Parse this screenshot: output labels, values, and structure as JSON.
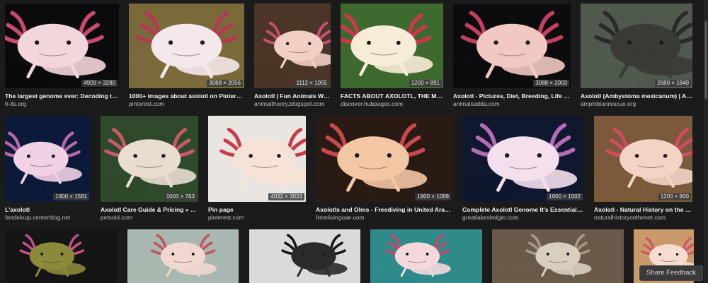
{
  "results": [
    {
      "title": "The largest genome ever: Decoding th...",
      "source": "h-its.org",
      "dims": "4928 × 3280",
      "colors": {
        "bg": "#0b0b0d",
        "body": "#f3d6dc",
        "gill": "#c94a6c"
      }
    },
    {
      "title": "1000+ images about axolotl on Pinteres...",
      "source": "pinterest.com",
      "dims": "3088 × 2056",
      "colors": {
        "bg": "#7a6a3a",
        "body": "#f4e8ea",
        "gill": "#b43a52"
      }
    },
    {
      "title": "Axolotl | Fun Animals Wiki...",
      "source": "animaltheory.blogspot.com",
      "dims": "1112 × 1055",
      "colors": {
        "bg": "#4a3526",
        "body": "#f1cfc4",
        "gill": "#c8506e"
      }
    },
    {
      "title": "FACTS ABOUT AXOLOTL, THE ME...",
      "source": "discover.hubpages.com",
      "dims": "1200 × 891",
      "colors": {
        "bg": "#3f6a2f",
        "body": "#f7ecd8",
        "gill": "#d8324e"
      }
    },
    {
      "title": "Axolotl - Pictures, Diet, Breeding, Life Cy...",
      "source": "animalsadda.com",
      "dims": "3088 × 2003",
      "colors": {
        "bg": "#0c0c0e",
        "body": "#f2c9c2",
        "gill": "#c4405e"
      }
    },
    {
      "title": "Axolotl (Ambystoma mexicanum) | Am...",
      "source": "amphibianrescue.org",
      "dims": "2680 × 1840",
      "colors": {
        "bg": "#4f5a4c",
        "body": "#3a3a36",
        "gill": "#2a2a28"
      }
    },
    {
      "title": "L'axolotl",
      "source": "fandeloup.centerblog.net",
      "dims": "1900 × 1581",
      "colors": {
        "bg": "#0c1a3a",
        "body": "#f0d2e4",
        "gill": "#b86aa8"
      }
    },
    {
      "title": "Axolotl Care Guide & Pricing » Pe...",
      "source": "petsoid.com",
      "dims": "1000 × 763",
      "colors": {
        "bg": "#2e4a2a",
        "body": "#e9ddd0",
        "gill": "#c9586a"
      }
    },
    {
      "title": "Pin page",
      "source": "pinterest.com",
      "dims": "4032 × 3024",
      "colors": {
        "bg": "#e9e6e1",
        "body": "#f6e2d6",
        "gill": "#cc3a4a"
      }
    },
    {
      "title": "Axolotls and Olms - Freediving in United Arab E...",
      "source": "freedivinguae.com",
      "dims": "1900 × 1069",
      "colors": {
        "bg": "#2a1a14",
        "body": "#f3c6a4",
        "gill": "#c8484e"
      }
    },
    {
      "title": "Complete Axolotl Genome It's Essential T...",
      "source": "greatlakesledger.com",
      "dims": "1600 × 1002",
      "colors": {
        "bg": "#101830",
        "body": "#f4e0ec",
        "gill": "#b46cb4"
      }
    },
    {
      "title": "Axolotl - Natural History on the Net",
      "source": "naturalhistoryonthenet.com",
      "dims": "1200 × 900",
      "colors": {
        "bg": "#7a5a3a",
        "body": "#f3d4c4",
        "gill": "#d24a64"
      }
    },
    {
      "title": "",
      "source": "",
      "dims": "",
      "colors": {
        "bg": "#151515",
        "body": "#8a8a3a",
        "gill": "#c4508a"
      }
    },
    {
      "title": "",
      "source": "",
      "dims": "",
      "colors": {
        "bg": "#a8b8b0",
        "body": "#f0d8d0",
        "gill": "#c85060"
      }
    },
    {
      "title": "",
      "source": "",
      "dims": "",
      "colors": {
        "bg": "#dadada",
        "body": "#2a2a2a",
        "gill": "#141414"
      }
    },
    {
      "title": "",
      "source": "",
      "dims": "",
      "colors": {
        "bg": "#2f8a8a",
        "body": "#f4d8dc",
        "gill": "#c8486a"
      }
    },
    {
      "title": "",
      "source": "",
      "dims": "",
      "colors": {
        "bg": "#6a5a4a",
        "body": "#d8cfc0",
        "gill": "#a89a86"
      }
    },
    {
      "title": "",
      "source": "",
      "dims": "",
      "colors": {
        "bg": "#c89a6a",
        "body": "#f6dcd0",
        "gill": "#d0506a"
      }
    }
  ],
  "feedback_label": "Share Feedback",
  "icons": {
    "thumbnail": "axolotl-image-icon"
  }
}
